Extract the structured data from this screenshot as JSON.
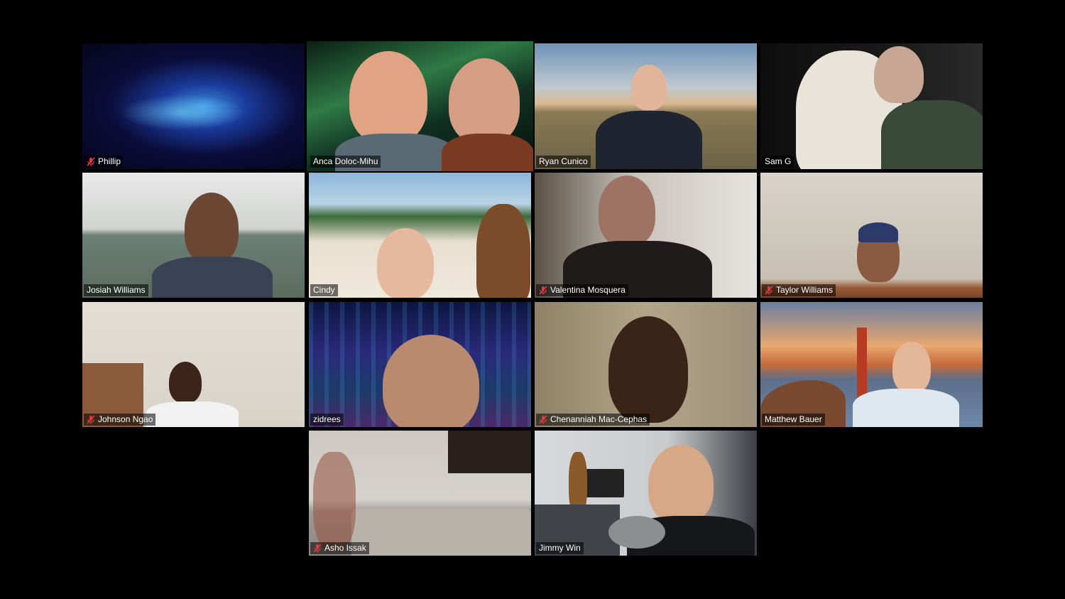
{
  "participants": [
    {
      "name": "Phillip",
      "muted": true,
      "active": false
    },
    {
      "name": "Anca Doloc-Mihu",
      "muted": false,
      "active": true
    },
    {
      "name": "Ryan Cunico",
      "muted": false,
      "active": false
    },
    {
      "name": "Sam G",
      "muted": false,
      "active": false
    },
    {
      "name": "Josiah Williams",
      "muted": false,
      "active": false
    },
    {
      "name": "Cindy",
      "muted": false,
      "active": false
    },
    {
      "name": "Valentina Mosquera",
      "muted": true,
      "active": false
    },
    {
      "name": "Taylor Williams",
      "muted": true,
      "active": false
    },
    {
      "name": "Johnson Ngao",
      "muted": true,
      "active": false
    },
    {
      "name": "zidrees",
      "muted": false,
      "active": false
    },
    {
      "name": "Chenanniah Mac-Cephas",
      "muted": true,
      "active": false
    },
    {
      "name": "Matthew Bauer",
      "muted": false,
      "active": false
    },
    {
      "name": "Asho Issak",
      "muted": true,
      "active": false
    },
    {
      "name": "Jimmy Win",
      "muted": false,
      "active": false
    }
  ],
  "colors": {
    "active_speaker_border": "#d7e45a",
    "mute_icon": "#e0393e"
  }
}
